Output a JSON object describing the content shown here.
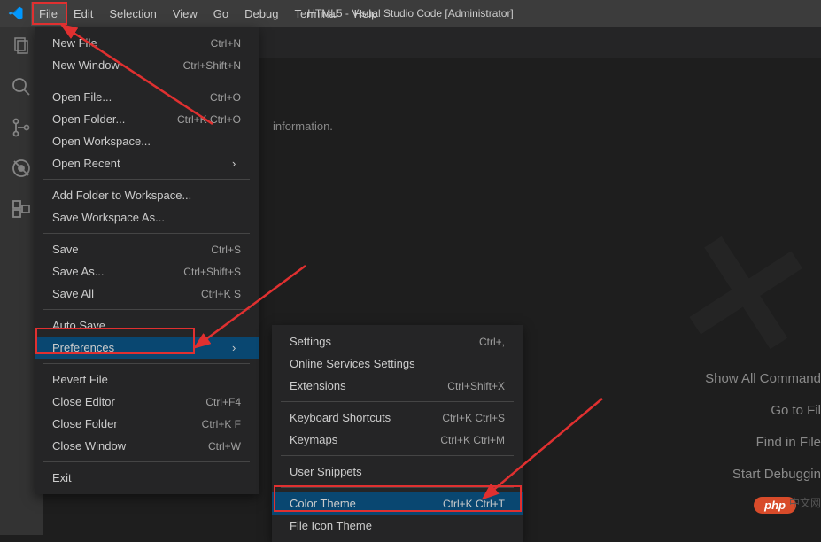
{
  "title": "HTML5 - Visual Studio Code [Administrator]",
  "menubar": [
    "File",
    "Edit",
    "Selection",
    "View",
    "Go",
    "Debug",
    "Terminal",
    "Help"
  ],
  "file_menu": {
    "groups": [
      [
        {
          "label": "New File",
          "shortcut": "Ctrl+N"
        },
        {
          "label": "New Window",
          "shortcut": "Ctrl+Shift+N"
        }
      ],
      [
        {
          "label": "Open File...",
          "shortcut": "Ctrl+O"
        },
        {
          "label": "Open Folder...",
          "shortcut": "Ctrl+K Ctrl+O"
        },
        {
          "label": "Open Workspace...",
          "shortcut": ""
        },
        {
          "label": "Open Recent",
          "shortcut": "",
          "sub": true
        }
      ],
      [
        {
          "label": "Add Folder to Workspace...",
          "shortcut": ""
        },
        {
          "label": "Save Workspace As...",
          "shortcut": ""
        }
      ],
      [
        {
          "label": "Save",
          "shortcut": "Ctrl+S"
        },
        {
          "label": "Save As...",
          "shortcut": "Ctrl+Shift+S"
        },
        {
          "label": "Save All",
          "shortcut": "Ctrl+K S"
        }
      ],
      [
        {
          "label": "Auto Save",
          "shortcut": ""
        },
        {
          "label": "Preferences",
          "shortcut": "",
          "sub": true,
          "hl": true
        }
      ],
      [
        {
          "label": "Revert File",
          "shortcut": ""
        },
        {
          "label": "Close Editor",
          "shortcut": "Ctrl+F4"
        },
        {
          "label": "Close Folder",
          "shortcut": "Ctrl+K F"
        },
        {
          "label": "Close Window",
          "shortcut": "Ctrl+W"
        }
      ],
      [
        {
          "label": "Exit",
          "shortcut": ""
        }
      ]
    ]
  },
  "pref_menu": {
    "groups": [
      [
        {
          "label": "Settings",
          "shortcut": "Ctrl+,"
        },
        {
          "label": "Online Services Settings",
          "shortcut": ""
        },
        {
          "label": "Extensions",
          "shortcut": "Ctrl+Shift+X"
        }
      ],
      [
        {
          "label": "Keyboard Shortcuts",
          "shortcut": "Ctrl+K Ctrl+S"
        },
        {
          "label": "Keymaps",
          "shortcut": "Ctrl+K Ctrl+M"
        }
      ],
      [
        {
          "label": "User Snippets",
          "shortcut": ""
        }
      ],
      [
        {
          "label": "Color Theme",
          "shortcut": "Ctrl+K Ctrl+T",
          "hl": true
        },
        {
          "label": "File Icon Theme",
          "shortcut": ""
        }
      ]
    ]
  },
  "welcome_text": "information.",
  "instructions": [
    "Show All Command",
    "Go to Fil",
    "Find in File",
    "Start Debuggin"
  ],
  "watermark": {
    "badge": "php",
    "text": "中文网"
  }
}
